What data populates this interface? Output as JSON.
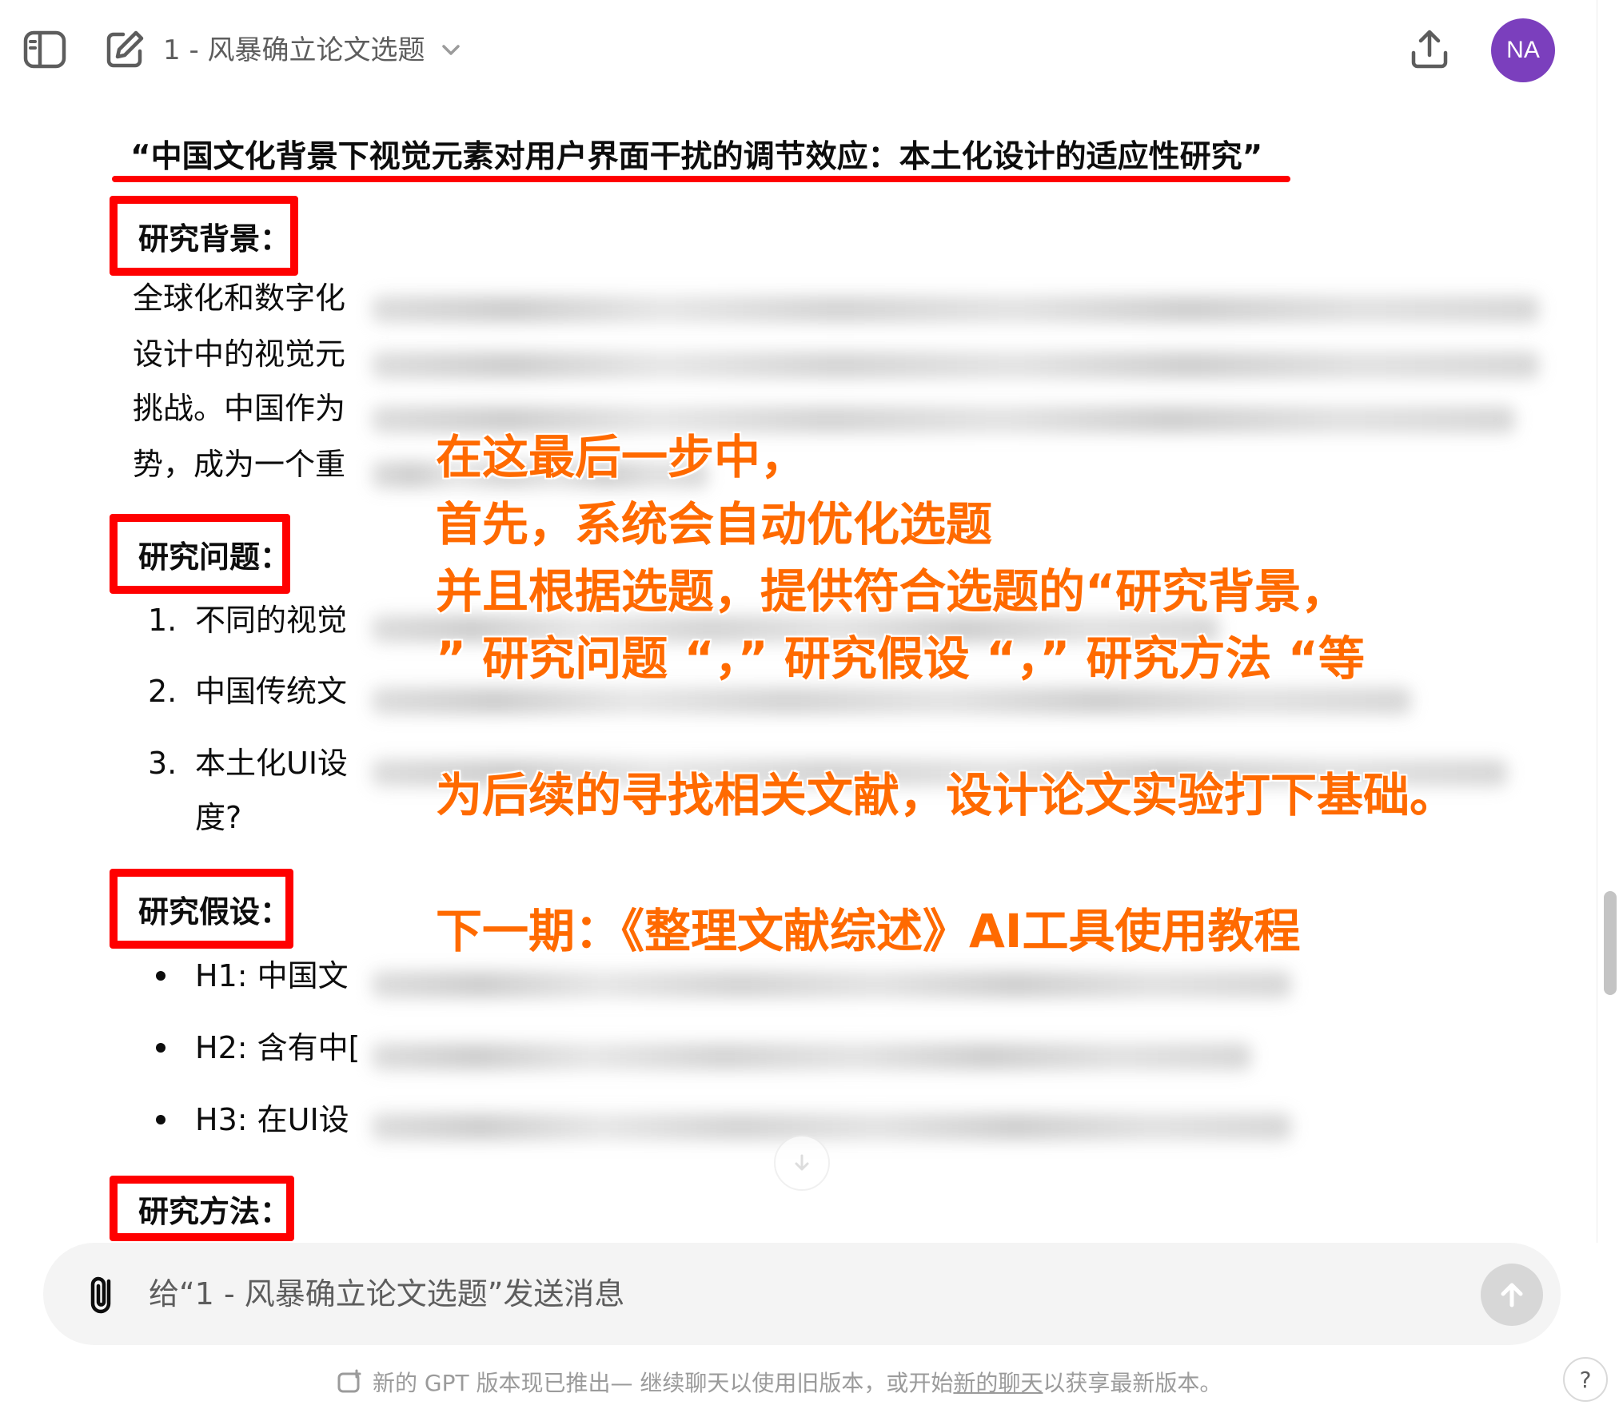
{
  "header": {
    "chat_title": "1 - 风暴确立论文选题",
    "avatar_initials": "NA",
    "avatar_color": "#7b3fbd"
  },
  "message": {
    "topic": "“中国文化背景下视觉元素对用户界面干扰的调节效应：本土化设计的适应性研究”",
    "background": {
      "heading": "研究背景：",
      "lines": [
        "全球化和数字化",
        "设计中的视觉元",
        "挑战。中国作为",
        "势，成为一个重"
      ]
    },
    "questions": {
      "heading": "研究问题：",
      "items": [
        {
          "num": "1.",
          "text": "不同的视觉"
        },
        {
          "num": "2.",
          "text": "中国传统文"
        },
        {
          "num": "3.",
          "text": "本土化UI设"
        },
        {
          "num": "",
          "text": "度?"
        }
      ]
    },
    "hypotheses": {
      "heading": "研究假设：",
      "items": [
        "H1: 中国文",
        "H2: 含有中[",
        "H3: 在UI设"
      ]
    },
    "methods": {
      "heading": "研究方法："
    }
  },
  "annotation": {
    "line1": "在这最后一步中，",
    "line2": "首先，系统会自动优化选题",
    "line3": "并且根据选题，提供符合选题的“研究背景，",
    "line4": "” 研究问题 “，” 研究假设 “，” 研究方法 “等",
    "line5": "为后续的寻找相关文献，设计论文实验打下基础。",
    "line6": "下一期：《整理文献综述》AI工具使用教程",
    "color": "#ff6a00"
  },
  "highlight_color": "#ff0000",
  "composer": {
    "placeholder": "给“1 - 风暴确立论文选题”发送消息"
  },
  "footer": {
    "notice_bold": "新的 GPT 版本现已推出",
    "notice_mid": " — 继续聊天以使用旧版本，或开始",
    "notice_link": "新的聊天",
    "notice_end": "以获享最新版本。",
    "help": "?"
  }
}
